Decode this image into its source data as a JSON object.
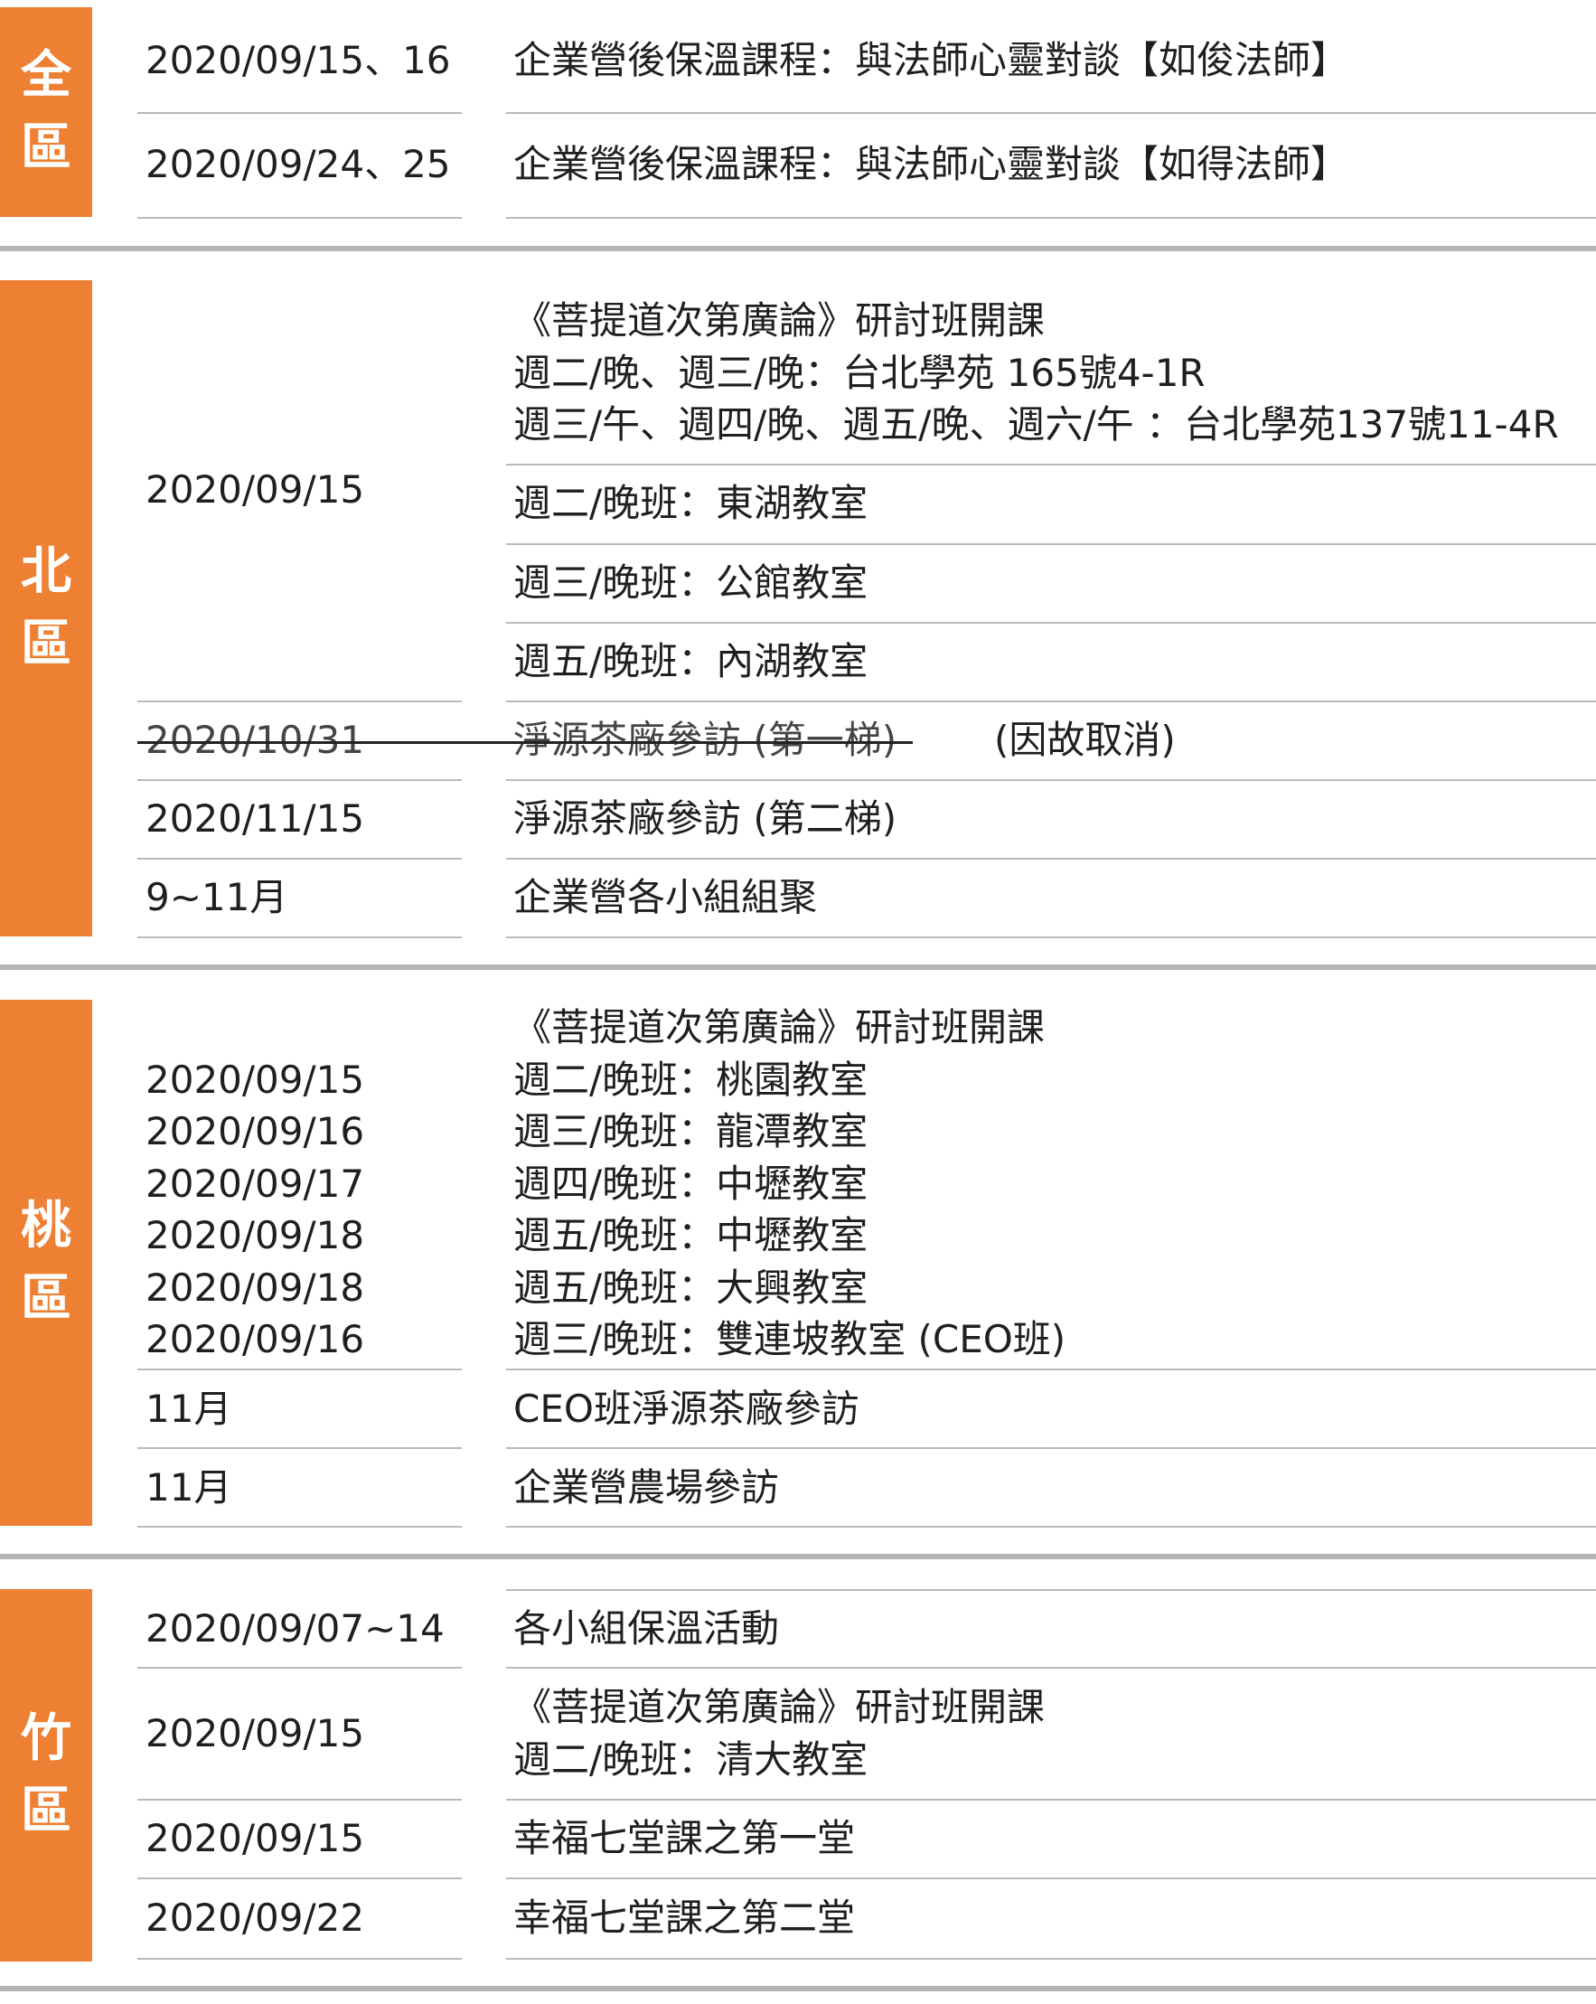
{
  "colors": {
    "accent": "#ee8034",
    "separator": "#b4b4b4",
    "rule": "#b9b9b9"
  },
  "regions": {
    "all": {
      "tag": [
        "全",
        "區"
      ],
      "rows": [
        {
          "date": "2020/09/15、16",
          "event": "企業營後保溫課程：與法師心靈對談【如俊法師】"
        },
        {
          "date": "2020/09/24、25",
          "event": "企業營後保溫課程：與法師心靈對談【如得法師】"
        }
      ]
    },
    "north": {
      "tag": [
        "北",
        "區"
      ],
      "date_1": "2020/09/15",
      "event_1_lines": [
        "《菩提道次第廣論》研討班開課",
        "週二/晚、週三/晚：台北學苑 165號4-1R",
        "週三/午、週四/晚、週五/晚、週六/午 ：台北學苑137號11-4R"
      ],
      "classes": [
        "週二/晚班：東湖教室",
        "週三/晚班：公館教室",
        "週五/晚班：內湖教室"
      ],
      "cancelled": {
        "date": "2020/10/31",
        "event": "淨源茶廠參訪 (第一梯)",
        "note": "(因故取消)"
      },
      "rows": [
        {
          "date": "2020/11/15",
          "event": "淨源茶廠參訪 (第二梯)"
        },
        {
          "date": "9~11月",
          "event": "企業營各小組組聚"
        }
      ]
    },
    "taoyuan": {
      "tag": [
        "桃",
        "區"
      ],
      "heading": "《菩提道次第廣論》研討班開課",
      "schedule": [
        {
          "date": "2020/09/15",
          "event": "週二/晚班：桃園教室"
        },
        {
          "date": "2020/09/16",
          "event": "週三/晚班：龍潭教室"
        },
        {
          "date": "2020/09/17",
          "event": "週四/晚班：中壢教室"
        },
        {
          "date": "2020/09/18",
          "event": "週五/晚班：中壢教室"
        },
        {
          "date": "2020/09/18",
          "event": "週五/晚班：大興教室"
        },
        {
          "date": "2020/09/16",
          "event": "週三/晚班：雙連坡教室 (CEO班)"
        }
      ],
      "rows": [
        {
          "date": "11月",
          "event": "CEO班淨源茶廠參訪"
        },
        {
          "date": "11月",
          "event": "企業營農場參訪"
        }
      ]
    },
    "hsinchu": {
      "tag": [
        "竹",
        "區"
      ],
      "row_1": {
        "date": "2020/09/07~14",
        "event": "各小組保溫活動"
      },
      "row_2": {
        "date": "2020/09/15",
        "event_lines": [
          "《菩提道次第廣論》研討班開課",
          "週二/晚班：清大教室"
        ]
      },
      "rows": [
        {
          "date": "2020/09/15",
          "event": "幸福七堂課之第一堂"
        },
        {
          "date": "2020/09/22",
          "event": "幸福七堂課之第二堂"
        }
      ]
    }
  }
}
